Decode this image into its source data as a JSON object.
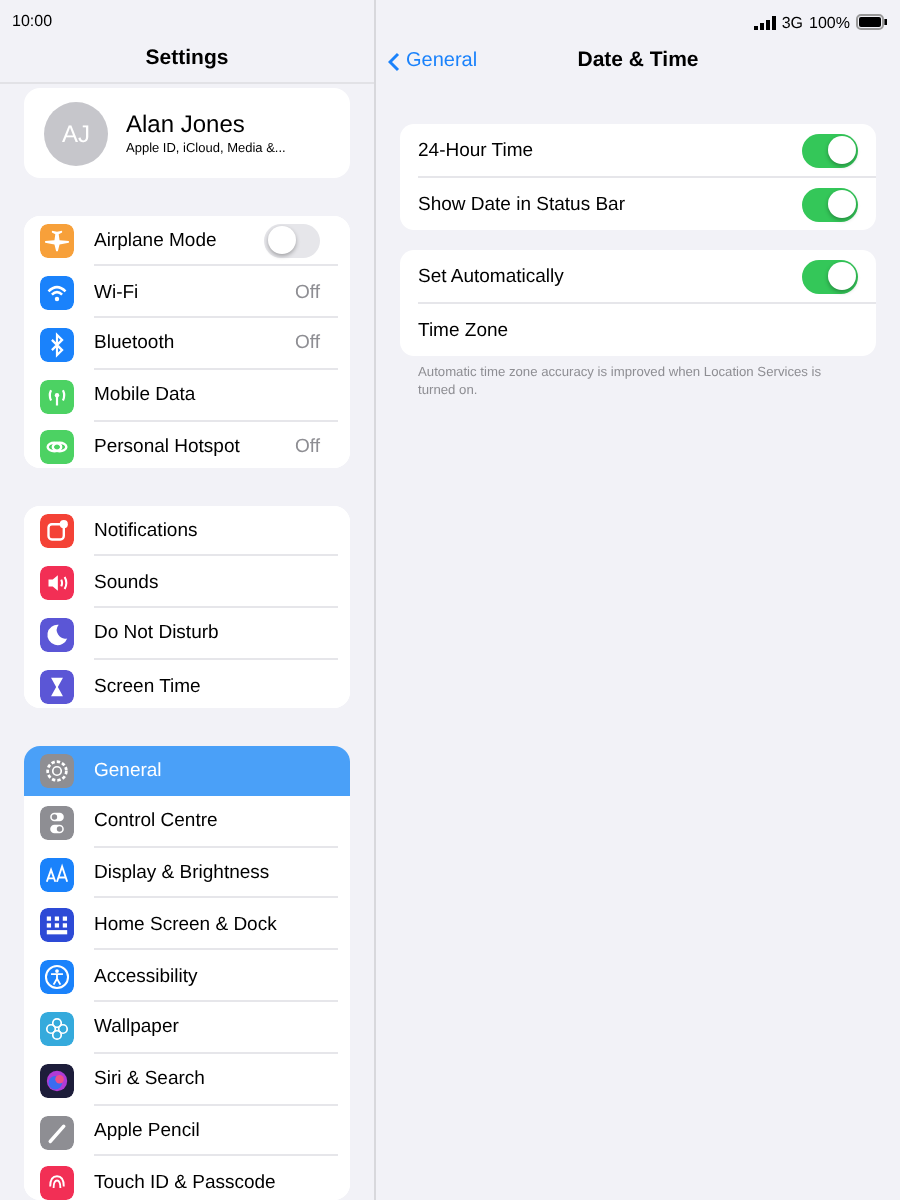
{
  "status_bar": {
    "time": "10:00",
    "network": "3G",
    "battery": "100%"
  },
  "sidebar": {
    "title": "Settings",
    "profile": {
      "initials": "AJ",
      "name": "Alan Jones",
      "subtitle": "Apple ID, iCloud, Media &..."
    },
    "groups": [
      {
        "items": [
          {
            "label": "Airplane Mode",
            "kind": "toggle",
            "on": false,
            "selected": false
          },
          {
            "label": "Wi-Fi",
            "kind": "link",
            "value": "Off",
            "selected": false
          },
          {
            "label": "Bluetooth",
            "kind": "link",
            "value": "Off",
            "selected": false
          },
          {
            "label": "Mobile Data",
            "kind": "link",
            "selected": false
          },
          {
            "label": "Personal Hotspot",
            "kind": "link",
            "value": "Off",
            "selected": false
          }
        ]
      },
      {
        "items": [
          {
            "label": "Notifications",
            "kind": "link",
            "selected": false
          },
          {
            "label": "Sounds",
            "kind": "link",
            "selected": false
          },
          {
            "label": "Do Not Disturb",
            "kind": "link",
            "selected": false
          },
          {
            "label": "Screen Time",
            "kind": "link",
            "selected": false
          }
        ]
      },
      {
        "items": [
          {
            "label": "General",
            "kind": "link",
            "selected": true
          },
          {
            "label": "Control Centre",
            "kind": "link",
            "selected": false
          },
          {
            "label": "Display & Brightness",
            "kind": "link",
            "selected": false
          },
          {
            "label": "Home Screen & Dock",
            "kind": "link",
            "selected": false
          },
          {
            "label": "Accessibility",
            "kind": "link",
            "selected": false
          },
          {
            "label": "Wallpaper",
            "kind": "link",
            "selected": false
          },
          {
            "label": "Siri & Search",
            "kind": "link",
            "selected": false
          },
          {
            "label": "Apple Pencil",
            "kind": "link",
            "selected": false
          },
          {
            "label": "Touch ID & Passcode",
            "kind": "link",
            "selected": false
          }
        ]
      }
    ]
  },
  "detail": {
    "back": "General",
    "title": "Date & Time",
    "groups": [
      {
        "rows": [
          {
            "label": "24-Hour Time",
            "kind": "toggle",
            "on": true
          },
          {
            "label": "Show Date in Status Bar",
            "kind": "toggle",
            "on": true
          }
        ]
      },
      {
        "rows": [
          {
            "label": "Set Automatically",
            "kind": "toggle",
            "on": true
          },
          {
            "label": "Time Zone",
            "kind": "link"
          }
        ],
        "footnote": "Automatic time zone accuracy is improved when Location Services is turned on."
      }
    ]
  }
}
